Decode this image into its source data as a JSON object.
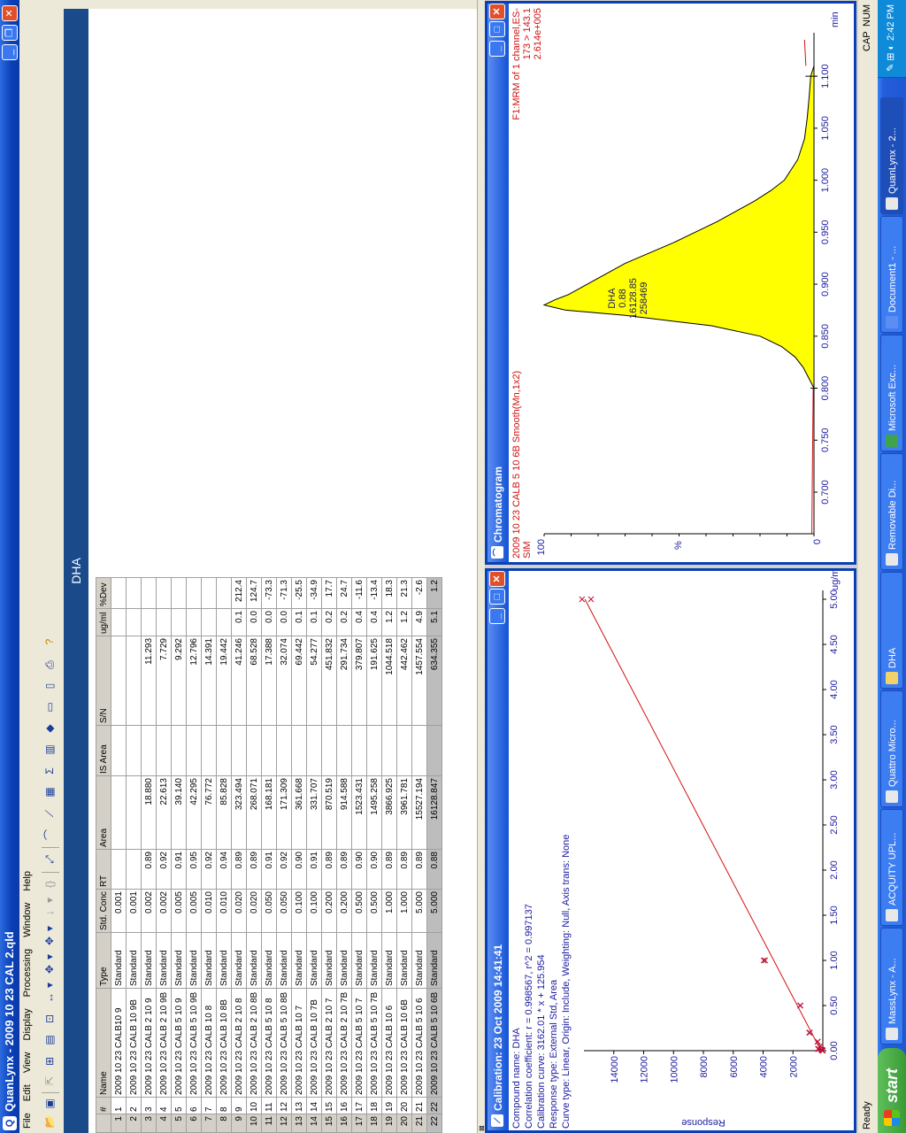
{
  "app": {
    "title": "QuanLynx - 2009 10 23 CAL 2.qld"
  },
  "menu": [
    "File",
    "Edit",
    "View",
    "Display",
    "Processing",
    "Window",
    "Help"
  ],
  "toolbar_icons": [
    "open-icon",
    "save-icon",
    "back-icon",
    "zoom-icon",
    "report-icon",
    "chart-icon",
    "arrows-icon",
    "dropdown-icon",
    "arrows2-icon",
    "dropdown2-icon",
    "arrows3-icon",
    "dropdown3-icon",
    "step-icon",
    "dropdown4-icon",
    "brace-icon",
    "fit-icon",
    "chromatogram-icon",
    "calibration-icon",
    "grid-icon",
    "sum-icon",
    "spectrum-icon",
    "dot-icon",
    "layout-icon",
    "layout2-icon",
    "print-icon",
    "help-icon"
  ],
  "section_header": "DHA",
  "table": {
    "columns": [
      "#",
      "Name",
      "Type",
      "Std. Conc",
      "RT",
      "Area",
      "IS Area",
      "S/N",
      "ug/ml",
      "%Dev"
    ],
    "rows": [
      [
        "1",
        "1",
        "2009 10 23 CALB10  9",
        "Standard",
        "0.001",
        "",
        "",
        "",
        "",
        "",
        ""
      ],
      [
        "2",
        "2",
        "2009 10 23 CALB 10  9B",
        "Standard",
        "0.001",
        "",
        "",
        "",
        "",
        "",
        ""
      ],
      [
        "3",
        "3",
        "2009 10 23 CALB 2 10  9",
        "Standard",
        "0.002",
        "0.89",
        "18.880",
        "",
        "11.293",
        "",
        ""
      ],
      [
        "4",
        "4",
        "2009 10 23 CALB 2 10  9B",
        "Standard",
        "0.002",
        "0.92",
        "22.613",
        "",
        "7.729",
        "",
        ""
      ],
      [
        "5",
        "5",
        "2009 10 23 CALB 5 10  9",
        "Standard",
        "0.005",
        "0.91",
        "39.140",
        "",
        "9.292",
        "",
        ""
      ],
      [
        "6",
        "6",
        "2009 10 23 CALB 5 10  9B",
        "Standard",
        "0.005",
        "0.95",
        "42.295",
        "",
        "12.796",
        "",
        ""
      ],
      [
        "7",
        "7",
        "2009 10 23 CALB 10  8",
        "Standard",
        "0.010",
        "0.92",
        "76.772",
        "",
        "14.391",
        "",
        ""
      ],
      [
        "8",
        "8",
        "2009 10 23 CALB 10  8B",
        "Standard",
        "0.010",
        "0.94",
        "85.828",
        "",
        "19.442",
        "",
        ""
      ],
      [
        "9",
        "9",
        "2009 10 23 CALB 2 10  8",
        "Standard",
        "0.020",
        "0.89",
        "323.494",
        "",
        "41.246",
        "0.1",
        "212.4"
      ],
      [
        "10",
        "10",
        "2009 10 23 CALB 2 10  8B",
        "Standard",
        "0.020",
        "0.89",
        "268.071",
        "",
        "68.528",
        "0.0",
        "124.7"
      ],
      [
        "11",
        "11",
        "2009 10 23 CALB 5 10  8",
        "Standard",
        "0.050",
        "0.91",
        "168.181",
        "",
        "17.388",
        "0.0",
        "-73.3"
      ],
      [
        "12",
        "12",
        "2009 10 23 CALB 5 10  8B",
        "Standard",
        "0.050",
        "0.92",
        "171.309",
        "",
        "32.074",
        "0.0",
        "-71.3"
      ],
      [
        "13",
        "13",
        "2009 10 23 CALB 10  7",
        "Standard",
        "0.100",
        "0.90",
        "361.668",
        "",
        "69.442",
        "0.1",
        "-25.5"
      ],
      [
        "14",
        "14",
        "2009 10 23 CALB 10  7B",
        "Standard",
        "0.100",
        "0.91",
        "331.707",
        "",
        "54.277",
        "0.1",
        "-34.9"
      ],
      [
        "15",
        "15",
        "2009 10 23 CALB 2 10  7",
        "Standard",
        "0.200",
        "0.89",
        "870.519",
        "",
        "451.832",
        "0.2",
        "17.7"
      ],
      [
        "16",
        "16",
        "2009 10 23 CALB 2 10  7B",
        "Standard",
        "0.200",
        "0.89",
        "914.588",
        "",
        "291.734",
        "0.2",
        "24.7"
      ],
      [
        "17",
        "17",
        "2009 10 23 CALB 5 10  7",
        "Standard",
        "0.500",
        "0.90",
        "1523.431",
        "",
        "379.807",
        "0.4",
        "-11.6"
      ],
      [
        "18",
        "18",
        "2009 10 23 CALB 5 10  7B",
        "Standard",
        "0.500",
        "0.90",
        "1495.258",
        "",
        "191.625",
        "0.4",
        "-13.4"
      ],
      [
        "19",
        "19",
        "2009 10 23 CALB 10  6",
        "Standard",
        "1.000",
        "0.89",
        "3866.925",
        "",
        "1044.518",
        "1.2",
        "18.3"
      ],
      [
        "20",
        "20",
        "2009 10 23 CALB 10  6B",
        "Standard",
        "1.000",
        "0.89",
        "3961.781",
        "",
        "442.462",
        "1.2",
        "21.3"
      ],
      [
        "21",
        "21",
        "2009 10 23 CALB 5 10  6",
        "Standard",
        "5.000",
        "0.89",
        "15527.194",
        "",
        "1457.554",
        "4.9",
        "-2.6"
      ],
      [
        "22",
        "22",
        "2009 10 23 CALB 5 10  6B",
        "Standard",
        "5.000",
        "0.88",
        "16128.847",
        "",
        "634.355",
        "5.1",
        "1.2"
      ]
    ]
  },
  "calibration": {
    "title": "Calibration:  23 Oct 2009 14:41:41",
    "lines": [
      "Compound name: DHA",
      "Correlation coefficient: r = 0.998567, r^2 = 0.997137",
      "Calibration curve: 3162.01 * x + 125.954",
      "Response type: External Std, Area",
      "Curve type: Linear, Origin: Include, Weighting: Null, Axis trans: None"
    ],
    "ylabel": "Response",
    "xunit": "ug/ml",
    "yticks": [
      "2000",
      "4000",
      "6000",
      "8000",
      "10000",
      "12000",
      "14000"
    ],
    "xticks": [
      "0.00",
      "0.50",
      "1.00",
      "1.50",
      "2.00",
      "2.50",
      "3.00",
      "3.50",
      "4.00",
      "4.50",
      "5.00"
    ]
  },
  "chromatogram": {
    "title": "Chromatogram",
    "line1": "2009 10 23 CALB 5 10  6B  Smooth(Mn,1x2)",
    "line2": "SIM",
    "right1": "F1:MRM of 1 channel,ES-",
    "right2": "173 > 143.1",
    "right3": "2.614e+005",
    "peak_labels": [
      "DHA",
      "0.88",
      "16128.85",
      "258469"
    ],
    "ytick_top": "100",
    "ytick_bottom": "0",
    "ylabel": "%",
    "xunit": "min",
    "xticks": [
      "0.700",
      "0.750",
      "0.800",
      "0.850",
      "0.900",
      "0.950",
      "1.000",
      "1.050",
      "1.100"
    ]
  },
  "chart_data": [
    {
      "type": "scatter",
      "title": "Calibration:  23 Oct 2009 14:41:41",
      "xlabel": "ug/ml",
      "ylabel": "Response",
      "xlim": [
        0,
        5.0
      ],
      "ylim": [
        0,
        16000
      ],
      "x": [
        0.001,
        0.001,
        0.002,
        0.002,
        0.005,
        0.005,
        0.01,
        0.01,
        0.02,
        0.02,
        0.05,
        0.05,
        0.1,
        0.1,
        0.2,
        0.2,
        0.5,
        0.5,
        1.0,
        1.0,
        5.0,
        5.0
      ],
      "y": [
        0,
        0,
        18.88,
        22.613,
        39.14,
        42.295,
        76.772,
        85.828,
        323.494,
        268.071,
        168.181,
        171.309,
        361.668,
        331.707,
        870.519,
        914.588,
        1523.431,
        1495.258,
        3866.925,
        3961.781,
        15527.194,
        16128.847
      ],
      "fit": {
        "slope": 3162.01,
        "intercept": 125.954
      },
      "colors": {
        "points": "#c0103a",
        "line": "#d01010"
      }
    },
    {
      "type": "area",
      "title": "Chromatogram",
      "xlabel": "min",
      "ylabel": "%",
      "xlim": [
        0.66,
        1.135
      ],
      "ylim": [
        0,
        100
      ],
      "x": [
        0.8,
        0.805,
        0.81,
        0.82,
        0.83,
        0.84,
        0.85,
        0.86,
        0.87,
        0.875,
        0.88,
        0.885,
        0.89,
        0.9,
        0.91,
        0.92,
        0.93,
        0.94,
        0.95,
        0.96,
        0.97,
        0.98,
        0.99,
        1.0,
        1.02,
        1.04,
        1.06,
        1.08,
        1.1,
        1.11
      ],
      "y": [
        0,
        1,
        2,
        4,
        7,
        12,
        20,
        38,
        70,
        92,
        100,
        96,
        91,
        84,
        77,
        70,
        61,
        52,
        44,
        36,
        29,
        22,
        16,
        11,
        6,
        3.5,
        2.5,
        1.8,
        1.2,
        0
      ],
      "colors": {
        "fill": "#ffff00",
        "stroke": "#000000"
      }
    }
  ],
  "statusbar": {
    "left": "Ready",
    "cap": "CAP",
    "num": "NUM"
  },
  "taskbar": {
    "start": "start",
    "buttons": [
      "MassLynx - A...",
      "ACQUITY UPL...",
      "Quattro Micro...",
      "DHA",
      "Removable Di...",
      "Microsoft Exc...",
      "Document1 - ...",
      "QuanLynx - 2..."
    ],
    "clock": "2:42 PM"
  }
}
